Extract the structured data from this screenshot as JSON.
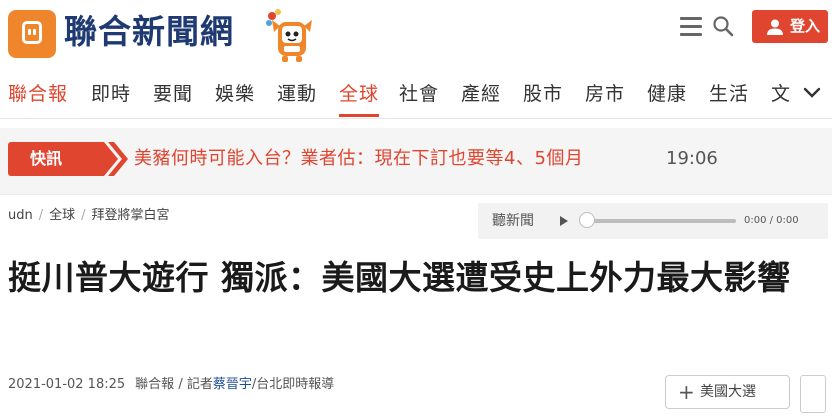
{
  "header": {
    "site_name": "聯合新聞網",
    "login_label": "登入",
    "icons": [
      "plug-logo-icon",
      "mascot-icon",
      "hamburger-menu-icon",
      "search-icon",
      "user-icon"
    ],
    "accent_color": "#e0452f",
    "logo_color": "#f0862b",
    "brand_text_color": "#1f3a73"
  },
  "nav": {
    "items": [
      "聯合報",
      "即時",
      "要聞",
      "娛樂",
      "運動",
      "全球",
      "社會",
      "產經",
      "股市",
      "房市",
      "健康",
      "生活",
      "文"
    ],
    "active": "全球",
    "more_icon": "chevron-down-icon"
  },
  "flash": {
    "badge": "快訊",
    "headline": "美豬何時可能入台？業者估：現在下訂也要等4、5個月",
    "time": "19:06"
  },
  "breadcrumb": [
    "udn",
    "全球",
    "拜登將掌白宮"
  ],
  "player": {
    "label": "聽新聞",
    "time": "0:00 / 0:00",
    "progress": 0
  },
  "article": {
    "title": "挺川普大遊行 獨派：美國大選遭受史上外力最大影響",
    "date": "2021-01-02 18:25",
    "source": "聯合報",
    "reporter_prefix": "/ 記者",
    "reporter": "蔡晉宇",
    "location": "/台北即時報導",
    "tag": "美國大選"
  }
}
